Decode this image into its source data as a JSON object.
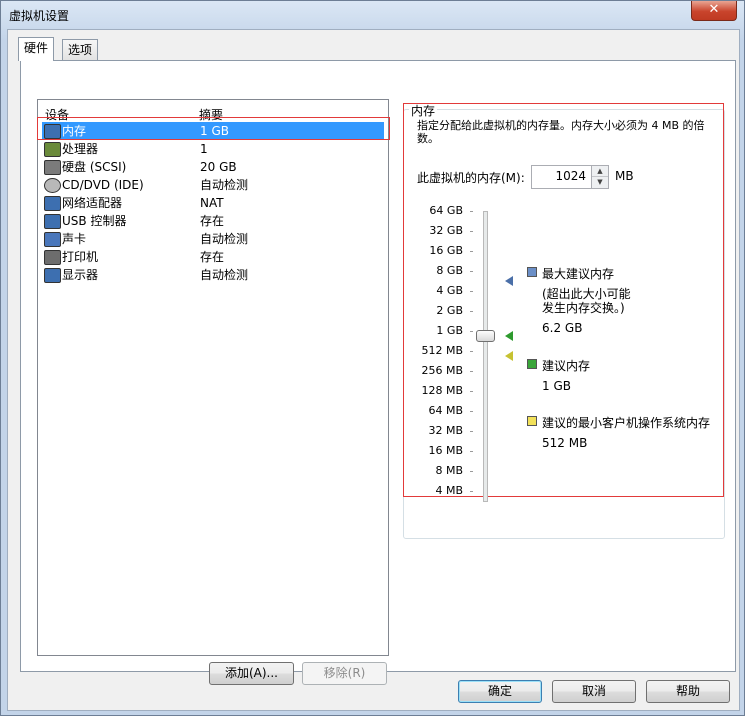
{
  "window": {
    "title": "虚拟机设置",
    "close_glyph": "✕"
  },
  "tabs": [
    {
      "label": "硬件"
    },
    {
      "label": "选项"
    }
  ],
  "device_list": {
    "col_device": "设备",
    "col_summary": "摘要",
    "rows": [
      {
        "name": "内存",
        "summary": "1 GB",
        "icon": "memory-icon"
      },
      {
        "name": "处理器",
        "summary": "1",
        "icon": "processor-icon"
      },
      {
        "name": "硬盘 (SCSI)",
        "summary": "20 GB",
        "icon": "hard-disk-icon"
      },
      {
        "name": "CD/DVD (IDE)",
        "summary": "自动检测",
        "icon": "cd-dvd-icon"
      },
      {
        "name": "网络适配器",
        "summary": "NAT",
        "icon": "network-adapter-icon"
      },
      {
        "name": "USB 控制器",
        "summary": "存在",
        "icon": "usb-icon"
      },
      {
        "name": "声卡",
        "summary": "自动检测",
        "icon": "sound-card-icon"
      },
      {
        "name": "打印机",
        "summary": "存在",
        "icon": "printer-icon"
      },
      {
        "name": "显示器",
        "summary": "自动检测",
        "icon": "display-icon"
      }
    ]
  },
  "buttons": {
    "add": "添加(A)...",
    "remove": "移除(R)",
    "ok": "确定",
    "cancel": "取消",
    "help": "帮助"
  },
  "memory": {
    "group_title": "内存",
    "description": "指定分配给此虚拟机的内存量。内存大小必须为 4 MB 的倍数。",
    "field_label": "此虚拟机的内存(M):",
    "field_value": "1024",
    "unit": "MB",
    "scale_labels": [
      "64 GB",
      "32 GB",
      "16 GB",
      "8 GB",
      "4 GB",
      "2 GB",
      "1 GB",
      "512 MB",
      "256 MB",
      "128 MB",
      "64 MB",
      "32 MB",
      "16 MB",
      "8 MB",
      "4 MB"
    ],
    "current_value_label": "1 GB",
    "legend": {
      "max": {
        "title": "最大建议内存",
        "note": "(超出此大小可能发生内存交换。)",
        "value": "6.2 GB",
        "color": "#6b8fc7"
      },
      "recommended": {
        "title": "建议内存",
        "value": "1 GB",
        "color": "#3aa63a"
      },
      "min": {
        "title": "建议的最小客户机操作系统内存",
        "value": "512 MB",
        "color": "#f2e15a"
      }
    }
  },
  "annotation_color": "#e23a3a"
}
